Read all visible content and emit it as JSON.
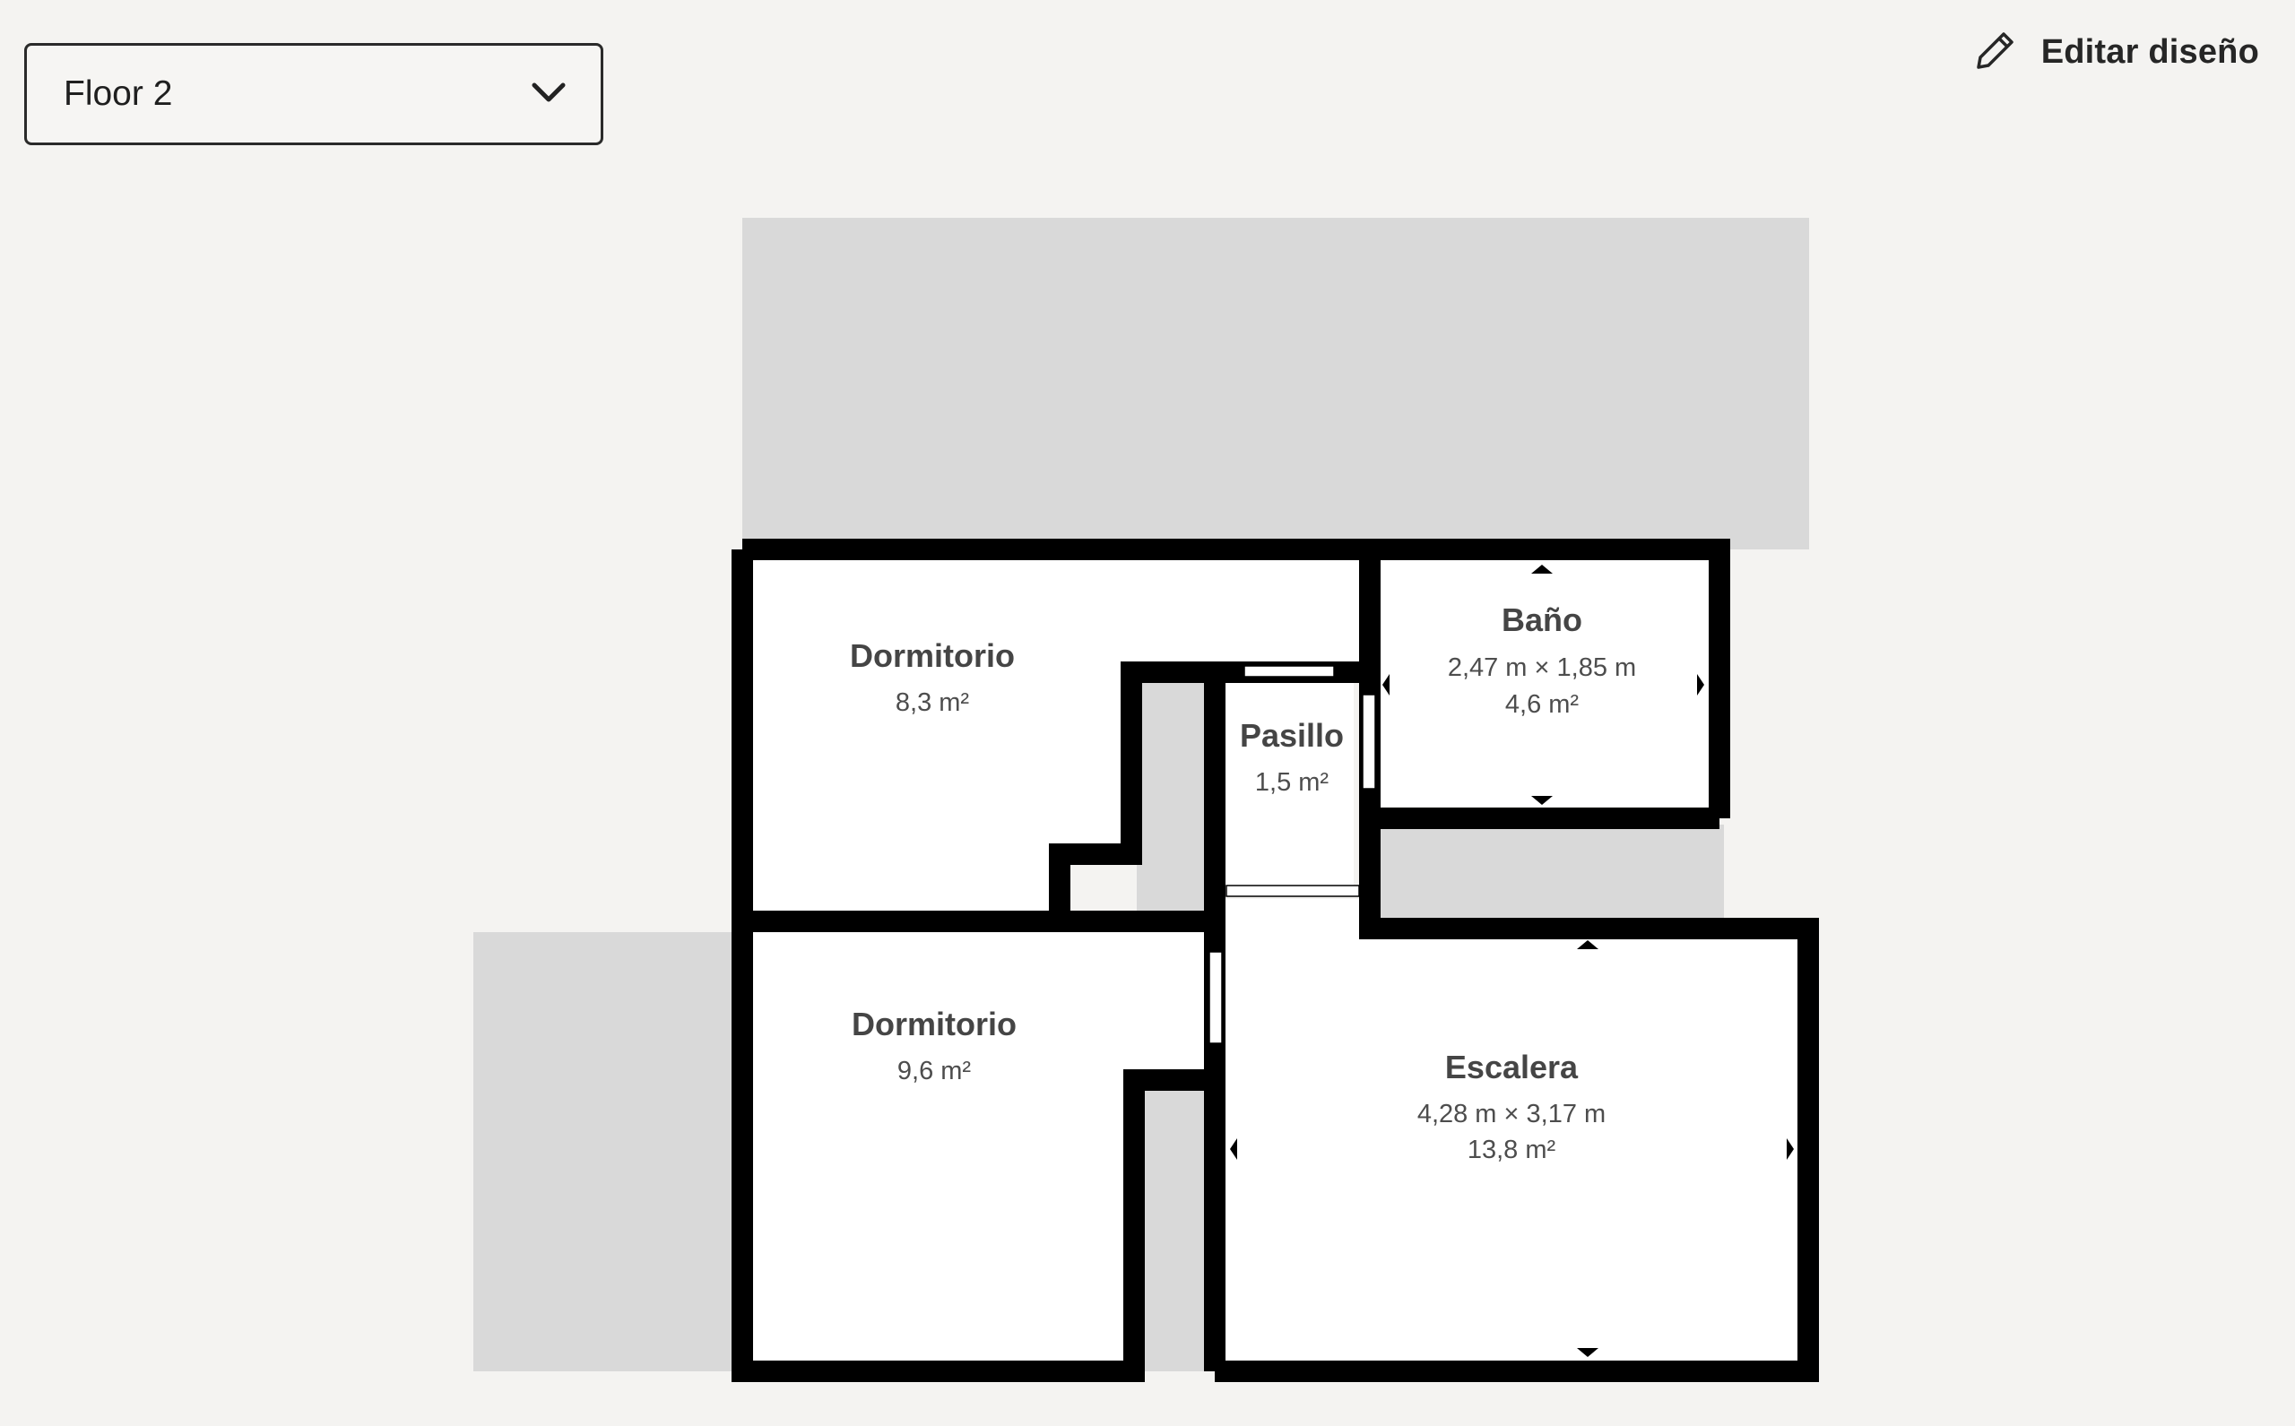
{
  "floor_selector": {
    "value": "Floor 2",
    "icon": "chevron-down-icon"
  },
  "edit_button": {
    "label": "Editar diseño",
    "icon": "pencil-icon"
  },
  "rooms": {
    "dormitorio_top": {
      "name": "Dormitorio",
      "area": "8,3 m²"
    },
    "dormitorio_bottom": {
      "name": "Dormitorio",
      "area": "9,6 m²"
    },
    "pasillo": {
      "name": "Pasillo",
      "area": "1,5 m²"
    },
    "bano": {
      "name": "Baño",
      "dimensions": "2,47 m × 1,85 m",
      "area": "4,6 m²"
    },
    "escalera": {
      "name": "Escalera",
      "dimensions": "4,28 m × 3,17 m",
      "area": "13,8 m²"
    }
  },
  "colors": {
    "background": "#f4f3f1",
    "wall": "#000000",
    "room_fill": "#ffffff",
    "outside_area": "#d9d9d9"
  }
}
